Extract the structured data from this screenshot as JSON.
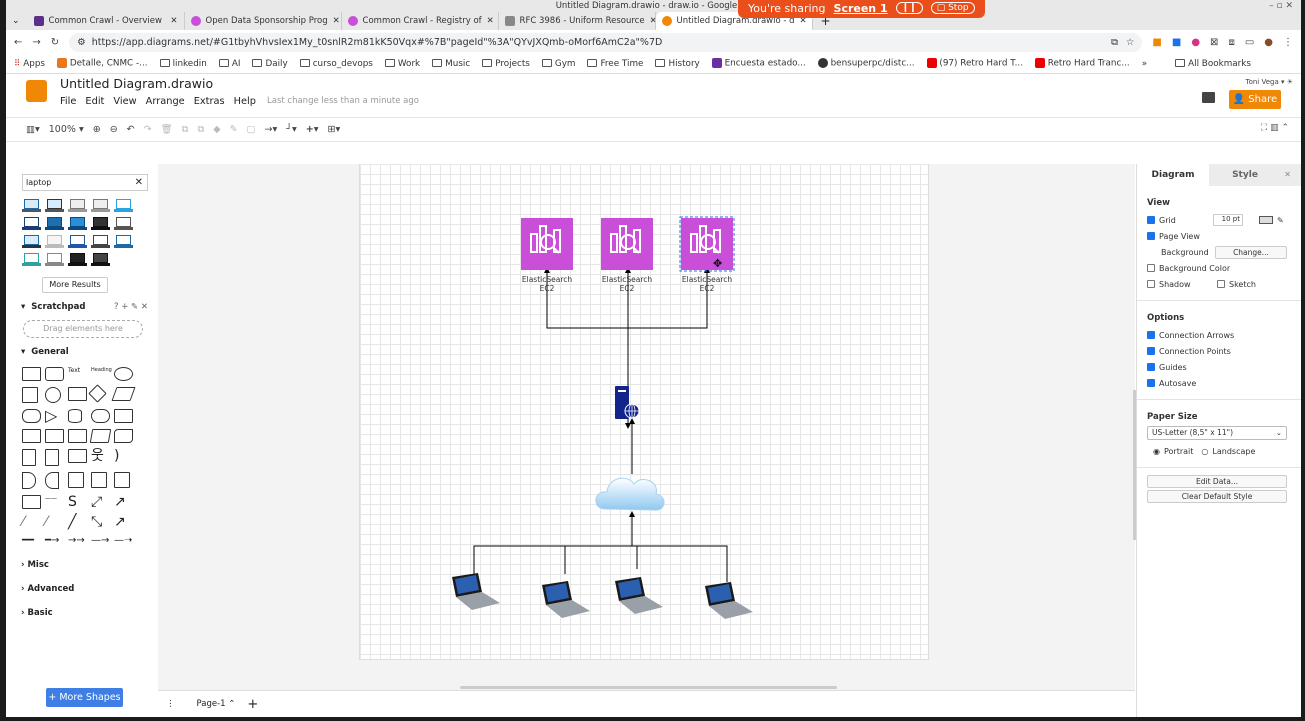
{
  "window": {
    "title": "Untitled Diagram.drawio - draw.io - Google Ch",
    "controls": "–  ▫  ✕"
  },
  "screen_share": {
    "text": "You're sharing",
    "screen": "Screen 1",
    "stop": "Stop"
  },
  "tabs": [
    {
      "label": "Common Crawl - Overview",
      "color": "#5b2f8a"
    },
    {
      "label": "Open Data Sponsorship Prog",
      "color": "#c94ed8"
    },
    {
      "label": "Common Crawl - Registry of",
      "color": "#c94ed8"
    },
    {
      "label": "RFC 3986 - Uniform Resource",
      "color": "#888888"
    },
    {
      "label": "Untitled Diagram.drawio - d",
      "color": "#f08705"
    }
  ],
  "address": {
    "url": "https://app.diagrams.net/#G1tbyhVhvsIex1My_t0snlR2m81kK50Vqx#%7B\"pageId\"%3A\"QYvJXQmb-oMorf6AmC2a\"%7D"
  },
  "bookmarks": [
    "Apps",
    "Detalle, CNMC -...",
    "linkedin",
    "AI",
    "Daily",
    "curso_devops",
    "Work",
    "Music",
    "Projects",
    "Gym",
    "Free Time",
    "History",
    "Encuesta estado...",
    "bensuperpc/distc...",
    "(97) Retro Hard T...",
    "Retro Hard Tranc...",
    "»",
    "All Bookmarks"
  ],
  "app": {
    "doc_title": "Untitled Diagram.drawio",
    "menus": [
      "File",
      "Edit",
      "View",
      "Arrange",
      "Extras",
      "Help"
    ],
    "last_change": "Last change less than a minute ago",
    "user": "Toni Vega",
    "share": "Share",
    "zoom": "100%"
  },
  "left_panel": {
    "search_value": "laptop",
    "more_results": "More Results",
    "scratchpad": "Scratchpad",
    "drag_hint": "Drag elements here",
    "general": "General",
    "collapsed": [
      "Misc",
      "Advanced",
      "Basic"
    ],
    "more_shapes": "+ More Shapes"
  },
  "diagram": {
    "es_label_1": "ElasticSearch",
    "es_label_2": "EC2",
    "es_color": "#c94ed8"
  },
  "page_bar": {
    "page": "Page-1"
  },
  "right_panel": {
    "tab_diagram": "Diagram",
    "tab_style": "Style",
    "view": "View",
    "grid": "Grid",
    "grid_size": "10 pt",
    "page_view": "Page View",
    "background": "Background",
    "change": "Change...",
    "bg_color": "Background Color",
    "shadow": "Shadow",
    "sketch": "Sketch",
    "options": "Options",
    "opt": [
      "Connection Arrows",
      "Connection Points",
      "Guides",
      "Autosave"
    ],
    "paper_size": "Paper Size",
    "paper_value": "US-Letter (8,5\" x 11\")",
    "portrait": "Portrait",
    "landscape": "Landscape",
    "edit_data": "Edit Data...",
    "clear_style": "Clear Default Style"
  }
}
